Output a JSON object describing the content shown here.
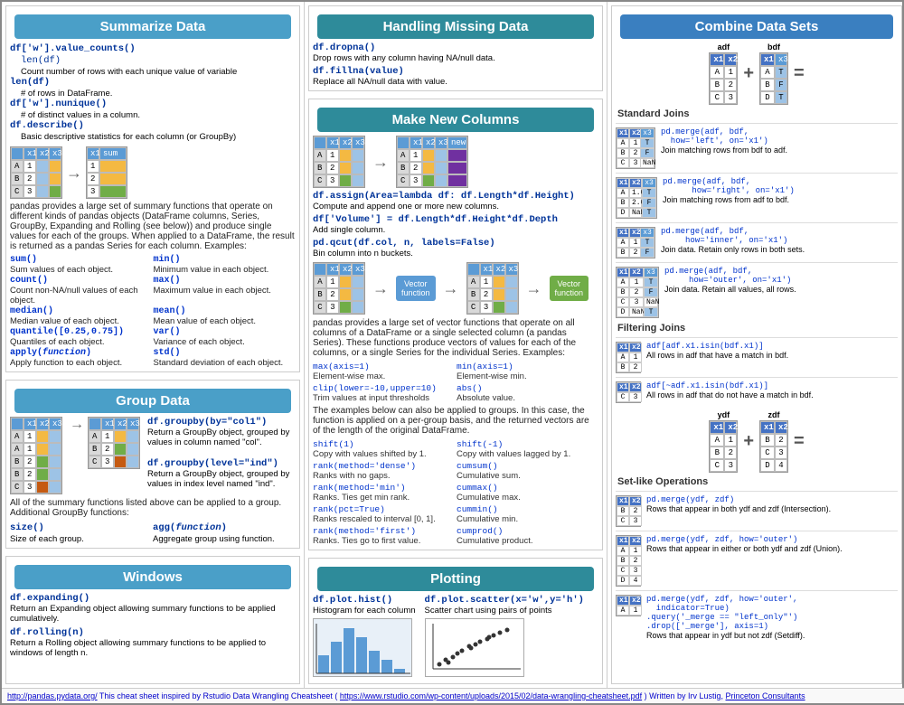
{
  "summarize": {
    "title": "Summarize Data",
    "lines": [
      "df['w'].value_counts()",
      "len(df)",
      "df['w'].nunique()",
      "df.describe()"
    ],
    "descs": [
      "Count number of rows with each unique value of variable",
      "# of rows in DataFrame.",
      "# of distinct values in a column.",
      "Basic descriptive statistics for each column (or GroupBy)"
    ],
    "intro": "pandas provides a large set of summary functions that operate on different kinds of pandas objects (DataFrame columns, Series, GroupBy, Expanding and Rolling (see below)) and produce single values for each of the groups. When applied to a DataFrame, the result is returned as a pandas Series for each column. Examples:",
    "functions": [
      {
        "name": "sum()",
        "desc": "Sum values of each object."
      },
      {
        "name": "min()",
        "desc": "Minimum value in each object."
      },
      {
        "name": "count()",
        "desc": "Count non-NA/null values of each object."
      },
      {
        "name": "max()",
        "desc": "Maximum value in each object."
      },
      {
        "name": "median()",
        "desc": "Median value of each object."
      },
      {
        "name": "mean()",
        "desc": "Mean value of each object."
      },
      {
        "name": "quantile([0.25,0.75])",
        "desc": "Quantiles of each object."
      },
      {
        "name": "var()",
        "desc": "Variance of each object."
      },
      {
        "name": "apply(function)",
        "desc": "Apply function to each object."
      },
      {
        "name": "std()",
        "desc": "Standard deviation of each object."
      }
    ]
  },
  "groupdata": {
    "title": "Group Data",
    "groupby1_code": "df.groupby(by=\"col1\")",
    "groupby1_desc": "Return a GroupBy object, grouped by values in column named \"col\".",
    "groupby2_code": "df.groupby(level=\"ind\")",
    "groupby2_desc": "Return a GroupBy object, grouped by values in index level named \"ind\".",
    "note": "All of the summary functions listed above can be applied to a group. Additional GroupBy functions:",
    "size_code": "size()",
    "size_desc": "Size of each group.",
    "agg_code": "agg(function)",
    "agg_desc": "Aggregate group using function."
  },
  "windows": {
    "title": "Windows",
    "expanding_code": "df.expanding()",
    "expanding_desc": "Return an Expanding object allowing summary functions to be applied cumulatively.",
    "rolling_code": "df.rolling(n)",
    "rolling_desc": "Return a Rolling object allowing summary functions to be applied to windows of length n."
  },
  "handling": {
    "title": "Handling Missing Data",
    "dropna_code": "df.dropna()",
    "dropna_desc": "Drop rows with any column having NA/null data.",
    "fillna_code": "df.fillna(value)",
    "fillna_desc": "Replace all NA/null data with value."
  },
  "makenew": {
    "title": "Make New Columns",
    "assign_code": "df.assign(Area=lambda df: df.Length*df.Height)",
    "assign_desc": "Compute and append one or more new columns.",
    "addcol_code": "df['Volume'] = df.Length*df.Height*df.Depth",
    "addcol_desc": "Add single column.",
    "qcut_code": "pd.qcut(df.col, n, labels=False)",
    "qcut_desc": "Bin column into n buckets.",
    "vector_intro": "pandas provides a large set of vector functions that operate on all columns of a DataFrame or a single selected column (a pandas Series). These functions produce vectors of values for each of the columns, or a single Series for the individual Series. Examples:",
    "functions": [
      {
        "name": "max(axis=1)",
        "desc": "Element-wise max."
      },
      {
        "name": "min(axis=1)",
        "desc": "Element-wise min."
      },
      {
        "name": "clip(lower=-10,upper=10)",
        "desc": "Trim values at input thresholds"
      },
      {
        "name": "abs()",
        "desc": "Absolute value."
      }
    ],
    "shift_note": "The examples below can also be applied to groups. In this case, the function is applied on a per-group basis, and the returned vectors are of the length of the original DataFrame.",
    "shifts": [
      {
        "name": "shift(1)",
        "desc": "Copy with values shifted by 1."
      },
      {
        "name": "shift(-1)",
        "desc": "Copy with values lagged by 1."
      },
      {
        "name": "rank(method='dense')",
        "desc": "Ranks with no gaps."
      },
      {
        "name": "cumsum()",
        "desc": "Cumulative sum."
      },
      {
        "name": "rank(method='min')",
        "desc": "Ranks. Ties get min rank."
      },
      {
        "name": "cummax()",
        "desc": "Cumulative max."
      },
      {
        "name": "rank(pct=True)",
        "desc": "Ranks rescaled to interval [0, 1]."
      },
      {
        "name": "cummin()",
        "desc": "Cumulative min."
      },
      {
        "name": "rank(method='first')",
        "desc": "Ranks. Ties go to first value."
      },
      {
        "name": "cumprod()",
        "desc": "Cumulative product."
      }
    ]
  },
  "plotting": {
    "title": "Plotting",
    "hist_code": "df.plot.hist()",
    "hist_desc": "Histogram for each column",
    "scatter_code": "df.plot.scatter(x='w',y='h')",
    "scatter_desc": "Scatter chart using pairs of points"
  },
  "combine": {
    "title": "Combine Data Sets",
    "standard_joins_label": "Standard Joins",
    "filtering_joins_label": "Filtering Joins",
    "set_ops_label": "Set-like Operations",
    "joins": [
      {
        "type": "left",
        "code": "pd.merge(adf, bdf,\n   how='left', on='x1')",
        "desc": "Join matching rows from bdf to adf."
      },
      {
        "type": "right",
        "code": "pd.merge(adf, bdf,\n      how='right', on='x1')",
        "desc": "Join matching rows from adf to bdf."
      },
      {
        "type": "inner",
        "code": "pd.merge(adf, bdf,\n     how='inner', on='x1')",
        "desc": "Join data. Retain only rows in both sets."
      },
      {
        "type": "outer",
        "code": "pd.merge(adf, bdf,\n     how='outer', on='x1')",
        "desc": "Join data. Retain all values, all rows."
      }
    ],
    "filter_joins": [
      {
        "code": "adf[adf.x1.isin(bdf.x1)]",
        "desc": "All rows in adf that have a match in bdf."
      },
      {
        "code": "adf[~adf.x1.isin(bdf.x1)]",
        "desc": "All rows in adf that do not have a match in bdf."
      }
    ],
    "set_ops": [
      {
        "code": "pd.merge(ydf, zdf)",
        "desc": "Rows that appear in both ydf and zdf (Intersection)."
      },
      {
        "code": "pd.merge(ydf, zdf, how='outer')",
        "desc": "Rows that appear in either or both ydf and zdf (Union)."
      },
      {
        "code": "pd.merge(ydf, zdf, how='outer',\n  indicator=True)\n.query('_merge == \"left_only\"')\n.drop(['_merge'], axis=1)",
        "desc": "Rows that appear in ydf but not zdf (Setdiff)."
      }
    ]
  },
  "footer": {
    "link1": "http://pandas.pydata.org/",
    "text1": "This cheat sheet inspired by Rstudio Data Wrangling Cheatsheet (",
    "link2": "https://www.rstudio.com/wp-content/uploads/2015/02/data-wrangling-cheatsheet.pdf",
    "text2": ") Written by Irv Lustig,",
    "link3": "Princeton Consultants"
  }
}
